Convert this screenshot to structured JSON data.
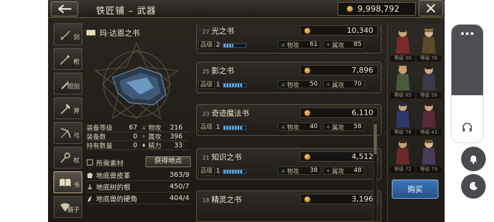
{
  "header": {
    "title": "铁匠铺 – 武器",
    "gold": "9,998,792"
  },
  "tabs": [
    {
      "label": "剑",
      "icon": "sword-icon"
    },
    {
      "label": "枪",
      "icon": "spear-icon"
    },
    {
      "label": "短剑",
      "icon": "dagger-icon"
    },
    {
      "label": "斧",
      "icon": "axe-icon"
    },
    {
      "label": "弓",
      "icon": "bow-icon"
    },
    {
      "label": "杖",
      "icon": "staff-icon"
    },
    {
      "label": "书",
      "icon": "book-icon",
      "active": true
    },
    {
      "label": "扇子",
      "icon": "fan-icon"
    }
  ],
  "detail": {
    "item_name": "玛·达恩之书",
    "stats": [
      {
        "k": "装备等级",
        "v": "67",
        "k2": "物攻",
        "v2": "216"
      },
      {
        "k": "装备数",
        "v": "0",
        "k2": "属攻",
        "v2": "396"
      },
      {
        "k": "持有数量",
        "v": "0",
        "k2": "精力",
        "v2": "33"
      }
    ],
    "materials_title": "所需素材",
    "get_location_label": "获得地点",
    "materials": [
      {
        "name": "地底兽皮革",
        "count": "363/9"
      },
      {
        "name": "地底树的根",
        "count": "450/7"
      },
      {
        "name": "地底兽的硬角",
        "count": "404/4"
      }
    ]
  },
  "list": [
    {
      "lvl": "27",
      "name": "光之书",
      "price": "10,340",
      "quality_label": "品级",
      "quality": "2",
      "quality_fill": 0.45,
      "phys_label": "物攻",
      "phys": "61",
      "elem_label": "属攻",
      "elem": "85"
    },
    {
      "lvl": "25",
      "name": "影之书",
      "price": "7,896",
      "quality_label": "品级",
      "quality": "1",
      "quality_fill": 0.85,
      "phys_label": "物攻",
      "phys": "50",
      "elem_label": "属攻",
      "elem": "70"
    },
    {
      "lvl": "23",
      "name": "奇迹魔法书",
      "price": "6,110",
      "quality_label": "品级",
      "quality": "1",
      "quality_fill": 0.85,
      "phys_label": "物攻",
      "phys": "40",
      "elem_label": "属攻",
      "elem": "58"
    },
    {
      "lvl": "21",
      "name": "知识之书",
      "price": "4,512",
      "quality_label": "品级",
      "quality": "1",
      "quality_fill": 0.85,
      "phys_label": "物攻",
      "phys": "38",
      "elem_label": "属攻",
      "elem": "48"
    },
    {
      "lvl": "18",
      "name": "精灵之书",
      "price": "3,196"
    }
  ],
  "party": {
    "members": [
      "等级 90",
      "等级 76",
      "等级 85",
      "等级 56",
      "等级 78",
      "等级 41",
      "等级 72",
      "等级 79"
    ],
    "buy_label": "购买"
  },
  "colors": {
    "accent": "#c8b48a",
    "buy_button": "#2f5f9e",
    "quality_bar": "#5fa5e0"
  }
}
